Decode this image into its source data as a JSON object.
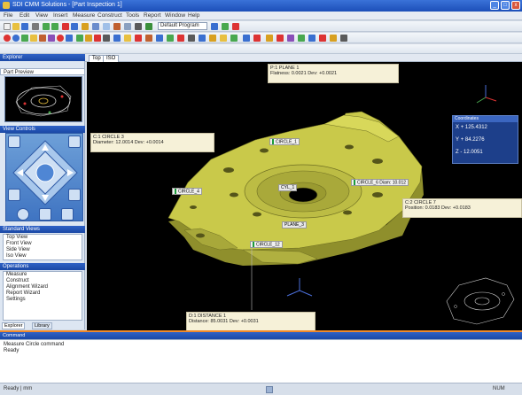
{
  "window": {
    "title": "SDI CMM Solutions - [Part Inspection 1]",
    "buttons": {
      "minimize": "_",
      "maximize": "□",
      "close": "x"
    }
  },
  "menu": [
    "File",
    "Edit",
    "View",
    "Insert",
    "Measure",
    "Construct",
    "Tools",
    "Report",
    "Window",
    "Help"
  ],
  "toolbar": {
    "combo_value": "Default Program"
  },
  "left_panel": {
    "explorer_title": "Explorer",
    "preview_title": "Part Preview",
    "nav_title": "View Controls",
    "standard_views_title": "Standard Views",
    "standard_views": [
      "Top View",
      "Front View",
      "Side View",
      "Iso View"
    ],
    "operations_title": "Operations",
    "operations": [
      "Measure",
      "Construct",
      "Alignment Wizard",
      "Report Wizard",
      "Settings"
    ],
    "bottom_tabs": [
      "Explorer",
      "Library"
    ]
  },
  "viewport": {
    "tabs": [
      "Top",
      "ISO"
    ],
    "callouts": [
      {
        "id": "top",
        "line1": "P:1    PLANE 1",
        "line2": "Flatness: 0.0021    Dev: +0.0021"
      },
      {
        "id": "left",
        "line1": "C:1    CIRCLE 3",
        "line2": "Diameter: 12.0014    Dev: +0.0014"
      },
      {
        "id": "right",
        "line1": "C:2    CIRCLE 7",
        "line2": "Position: 0.0183    Dev: +0.0183"
      },
      {
        "id": "bottom",
        "line1": "D:1    DISTANCE 1",
        "line2": "Distance: 85.0031    Dev: +0.0031"
      }
    ],
    "tags": [
      {
        "id": "t1",
        "text": "CIRCLE_1"
      },
      {
        "id": "t2",
        "text": "CIRCLE_4"
      },
      {
        "id": "t3",
        "text": "CYL_1"
      },
      {
        "id": "t4",
        "text": "CIRCLE_6   Diam: 10.012"
      },
      {
        "id": "t5",
        "text": "CIRCLE_12"
      },
      {
        "id": "t6",
        "text": "PLANE_3"
      }
    ]
  },
  "coord_panel": {
    "title": "Coordinates",
    "x_label": "X",
    "x_value": "+ 125.4312",
    "y_label": "Y",
    "y_value": "+ 84.2276",
    "z_label": "Z",
    "z_value": "- 12.0051"
  },
  "command": {
    "title": "Command",
    "lines": [
      "Measure Circle command",
      "Ready"
    ]
  },
  "status": {
    "left": "Ready  |  mm",
    "right": "NUM"
  },
  "colors": {
    "part_fill": "#c9c94a",
    "part_shade": "#8f8f2c",
    "title_blue": "#1c4fb8",
    "viewport_bg": "#000000"
  }
}
